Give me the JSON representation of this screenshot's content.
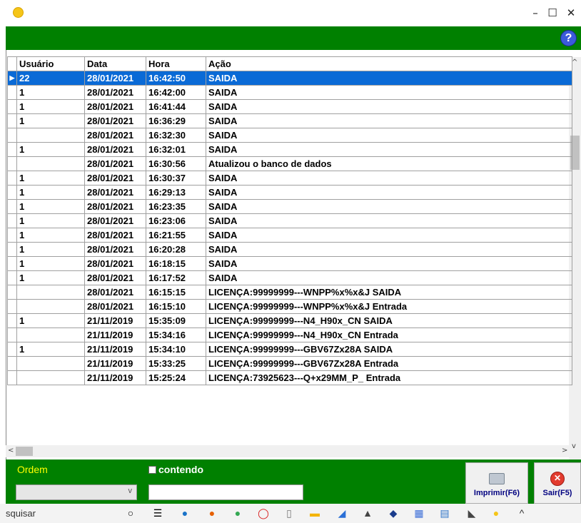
{
  "window": {
    "minimize": "–",
    "maximize": "☐",
    "close": "✕",
    "help": "?"
  },
  "grid": {
    "columns": [
      "Usuário",
      "Data",
      "Hora",
      "Ação"
    ],
    "rows": [
      {
        "usuario": "22",
        "data": "28/01/2021",
        "hora": "16:42:50",
        "acao": " SAIDA",
        "selected": true
      },
      {
        "usuario": "1",
        "data": "28/01/2021",
        "hora": "16:42:00",
        "acao": " SAIDA"
      },
      {
        "usuario": "1",
        "data": "28/01/2021",
        "hora": "16:41:44",
        "acao": " SAIDA"
      },
      {
        "usuario": "1",
        "data": "28/01/2021",
        "hora": "16:36:29",
        "acao": " SAIDA"
      },
      {
        "usuario": "",
        "data": "28/01/2021",
        "hora": "16:32:30",
        "acao": " SAIDA"
      },
      {
        "usuario": "1",
        "data": "28/01/2021",
        "hora": "16:32:01",
        "acao": " SAIDA"
      },
      {
        "usuario": "",
        "data": "28/01/2021",
        "hora": "16:30:56",
        "acao": "Atualizou o banco de dados"
      },
      {
        "usuario": "1",
        "data": "28/01/2021",
        "hora": "16:30:37",
        "acao": " SAIDA"
      },
      {
        "usuario": "1",
        "data": "28/01/2021",
        "hora": "16:29:13",
        "acao": " SAIDA"
      },
      {
        "usuario": "1",
        "data": "28/01/2021",
        "hora": "16:23:35",
        "acao": " SAIDA"
      },
      {
        "usuario": "1",
        "data": "28/01/2021",
        "hora": "16:23:06",
        "acao": " SAIDA"
      },
      {
        "usuario": "1",
        "data": "28/01/2021",
        "hora": "16:21:55",
        "acao": " SAIDA"
      },
      {
        "usuario": "1",
        "data": "28/01/2021",
        "hora": "16:20:28",
        "acao": " SAIDA"
      },
      {
        "usuario": "1",
        "data": "28/01/2021",
        "hora": "16:18:15",
        "acao": " SAIDA"
      },
      {
        "usuario": "1",
        "data": "28/01/2021",
        "hora": "16:17:52",
        "acao": " SAIDA"
      },
      {
        "usuario": "",
        "data": "28/01/2021",
        "hora": "16:15:15",
        "acao": "LICENÇA:99999999---WNPP%x%x&J SAIDA"
      },
      {
        "usuario": "",
        "data": "28/01/2021",
        "hora": "16:15:10",
        "acao": "LICENÇA:99999999---WNPP%x%x&J Entrada"
      },
      {
        "usuario": "1",
        "data": "21/11/2019",
        "hora": "15:35:09",
        "acao": "LICENÇA:99999999---N4_H90x_CN SAIDA"
      },
      {
        "usuario": "",
        "data": "21/11/2019",
        "hora": "15:34:16",
        "acao": "LICENÇA:99999999---N4_H90x_CN Entrada"
      },
      {
        "usuario": "1",
        "data": "21/11/2019",
        "hora": "15:34:10",
        "acao": "LICENÇA:99999999---GBV67Zx28A SAIDA"
      },
      {
        "usuario": "",
        "data": "21/11/2019",
        "hora": "15:33:25",
        "acao": "LICENÇA:99999999---GBV67Zx28A Entrada"
      },
      {
        "usuario": "",
        "data": "21/11/2019",
        "hora": "15:25:24",
        "acao": "LICENÇA:73925623---Q+x29MM_P_ Entrada"
      }
    ]
  },
  "filters": {
    "ordem_label": "Ordem",
    "contendo_label": "contendo",
    "ordem_value": "",
    "search_value": ""
  },
  "buttons": {
    "print": "Imprimir(F6)",
    "exit": "Sair(F5)"
  },
  "taskbar": {
    "search_text": "squisar"
  },
  "colors": {
    "green": "#008000",
    "selection": "#0a6ad6",
    "ordem_label": "#ffff00"
  }
}
